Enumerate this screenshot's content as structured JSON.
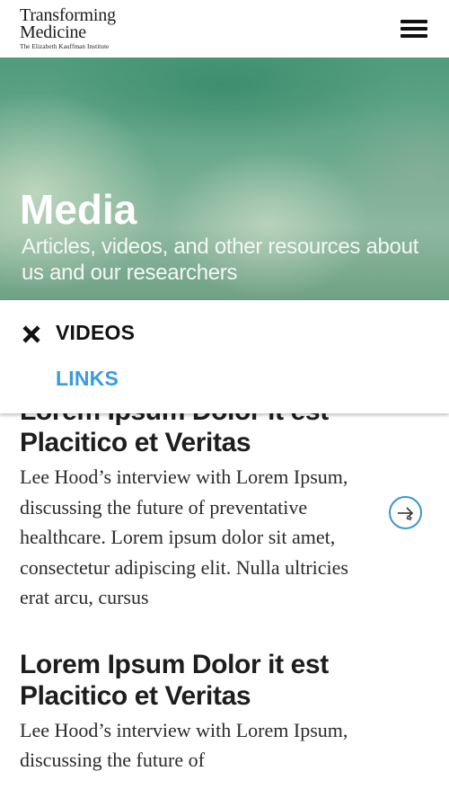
{
  "header": {
    "logo_line1": "Transforming",
    "logo_line2": "Medicine",
    "logo_tagline": "The Elizabeth Kauffman Institute",
    "menu_icon": "hamburger-menu-icon"
  },
  "hero": {
    "title": "Media",
    "subtitle": "Articles, videos, and other resources about us and our researchers"
  },
  "filter": {
    "close_icon": "close-icon",
    "items": [
      {
        "label": "VIDEOS",
        "selected": true
      },
      {
        "label": "LINKS",
        "selected": false
      }
    ],
    "link_color": "#3a9be0"
  },
  "articles": [
    {
      "title": "Lorem Ipsum Dolor it est Placitico et Veritas",
      "body": "Lee Hood’s interview with Lorem Ipsum, discussing the future of preventative healthcare. Lorem ipsum dolor sit amet, consectetur adipiscing elit. Nulla ultricies erat arcu, cursus",
      "arrow_icon": "arrow-right-circle-icon"
    },
    {
      "title": "Lorem Ipsum Dolor it est Placitico et Veritas",
      "body": "Lee Hood’s interview with Lorem Ipsum, discussing the future of"
    }
  ],
  "colors": {
    "accent": "#3a95d1",
    "hero_green": "#5fa386"
  }
}
